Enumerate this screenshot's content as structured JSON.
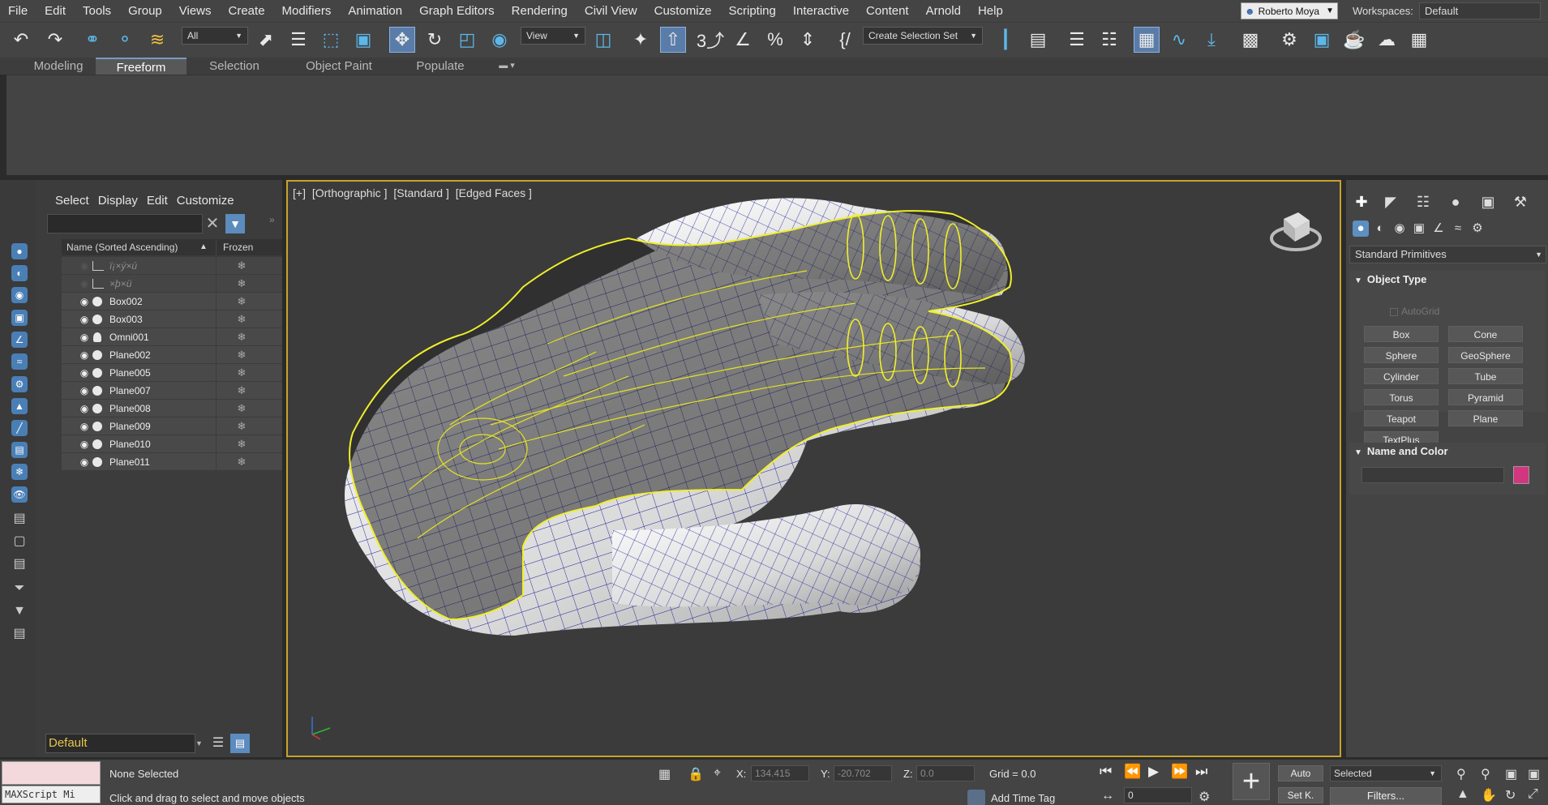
{
  "menu": [
    "File",
    "Edit",
    "Tools",
    "Group",
    "Views",
    "Create",
    "Modifiers",
    "Animation",
    "Graph Editors",
    "Rendering",
    "Civil View",
    "Customize",
    "Scripting",
    "Interactive",
    "Content",
    "Arnold",
    "Help"
  ],
  "user": {
    "name": "Roberto Moya"
  },
  "workspaces": {
    "label": "Workspaces:",
    "value": "Default"
  },
  "toolbar": {
    "selection_filter": "All",
    "ref_coord": "View",
    "selection_set": "Create Selection Set"
  },
  "ribbon_tabs": [
    "Modeling",
    "Freeform",
    "Selection",
    "Object Paint",
    "Populate"
  ],
  "ribbon_active": "Freeform",
  "scene_explorer": {
    "menu": [
      "Select",
      "Display",
      "Edit",
      "Customize"
    ],
    "search_placeholder": "",
    "col_name": "Name (Sorted Ascending)",
    "col_frozen": "Frozen",
    "rows": [
      {
        "name": "ï¡×ý×ú",
        "type": "camera",
        "visible": false
      },
      {
        "name": "×þ×ü",
        "type": "camera",
        "visible": false
      },
      {
        "name": "Box002",
        "type": "geometry",
        "visible": true
      },
      {
        "name": "Box003",
        "type": "geometry",
        "visible": true
      },
      {
        "name": "Omni001",
        "type": "light",
        "visible": true
      },
      {
        "name": "Plane002",
        "type": "geometry",
        "visible": true
      },
      {
        "name": "Plane005",
        "type": "geometry",
        "visible": true
      },
      {
        "name": "Plane007",
        "type": "geometry",
        "visible": true
      },
      {
        "name": "Plane008",
        "type": "geometry",
        "visible": true
      },
      {
        "name": "Plane009",
        "type": "geometry",
        "visible": true
      },
      {
        "name": "Plane010",
        "type": "geometry",
        "visible": true
      },
      {
        "name": "Plane011",
        "type": "geometry",
        "visible": true
      }
    ],
    "layer": "Default"
  },
  "viewport": {
    "labels": [
      "[+]",
      "[Orthographic ]",
      "[Standard ]",
      "[Edged Faces ]"
    ]
  },
  "command_panel": {
    "category": "Standard Primitives",
    "object_type_title": "Object Type",
    "autogrid": "AutoGrid",
    "primitives": [
      "Box",
      "Cone",
      "Sphere",
      "GeoSphere",
      "Cylinder",
      "Tube",
      "Torus",
      "Pyramid",
      "Teapot",
      "Plane",
      "TextPlus"
    ],
    "name_color_title": "Name and Color",
    "object_color": "#d23681"
  },
  "status": {
    "maxscript": "MAXScript Mi",
    "selection": "None Selected",
    "prompt": "Click and drag to select and move objects",
    "x_label": "X:",
    "x": "134.415",
    "y_label": "Y:",
    "y": "-20.702",
    "z_label": "Z:",
    "z": "0.0",
    "grid": "Grid = 0.0",
    "add_time_tag": "Add Time Tag",
    "frame": "0",
    "auto_key": "Auto",
    "set_key": "Set K.",
    "key_filter": "Selected",
    "filters": "Filters..."
  }
}
